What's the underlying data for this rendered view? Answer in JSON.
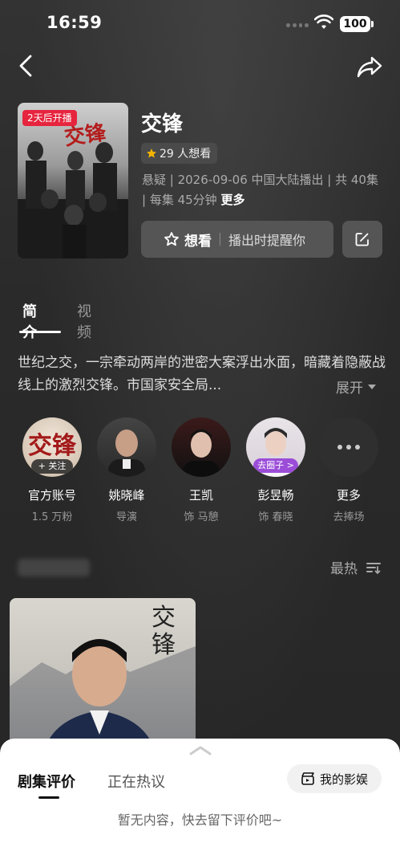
{
  "status_bar": {
    "time": "16:59",
    "battery": "100"
  },
  "show": {
    "title": "交锋",
    "poster_badge": "2天后开播",
    "want_count": "29 人想看",
    "meta": "悬疑 | 2026-09-06 中国大陆播出 | 共 40集 | 每集 45分钟",
    "meta_more": "更多",
    "want_label": "想看",
    "remind_label": "播出时提醒你"
  },
  "tabs": [
    {
      "label": "简介"
    },
    {
      "label": "视频"
    }
  ],
  "synopsis": {
    "text": "世纪之交，一宗牵动两岸的泄密大案浮出水面，暗藏着隐蔽战线上的激烈交锋。市国家安全局...",
    "expand_label": "展开"
  },
  "people": [
    {
      "name": "官方账号",
      "role": "1.5 万粉",
      "tag": "+ 关注"
    },
    {
      "name": "姚晓峰",
      "role": "导演"
    },
    {
      "name": "王凯",
      "role": "饰 马憩"
    },
    {
      "name": "彭昱畅",
      "role": "饰 春晓",
      "tag": "去圈子 >"
    },
    {
      "name": "更多",
      "role": "去捧场"
    }
  ],
  "hot": {
    "sort_label": "最热"
  },
  "sheet": {
    "tab_reviews": "剧集评价",
    "tab_hot": "正在热议",
    "my_movies": "我的影娱",
    "empty_text": "暂无内容，快去留下评价吧~"
  }
}
